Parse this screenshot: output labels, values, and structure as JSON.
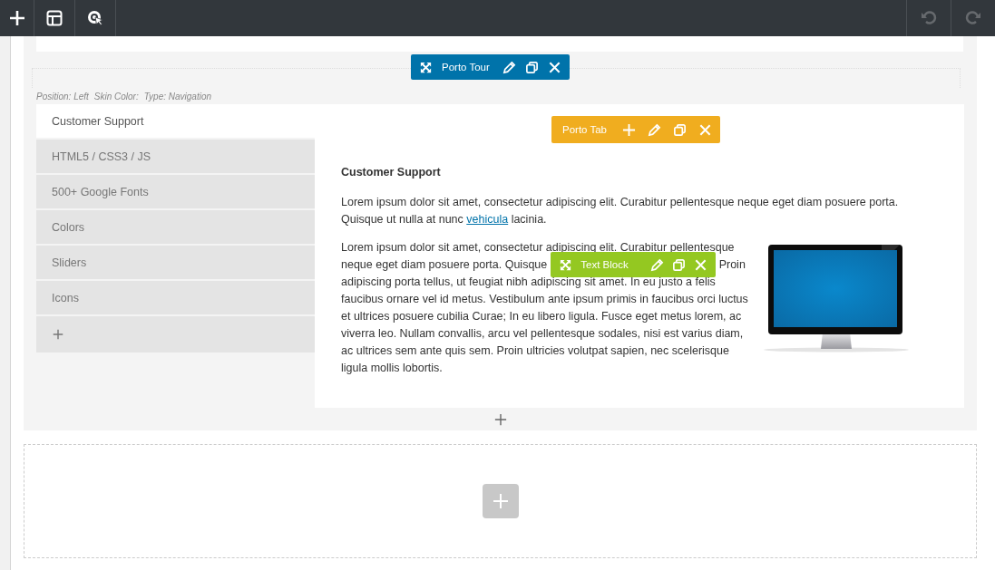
{
  "topbar": {
    "history": [
      {
        "kind": "undo",
        "disabled": true
      },
      {
        "kind": "redo",
        "disabled": true
      }
    ]
  },
  "tour_controls": {
    "title": "Porto Tour"
  },
  "tour_meta": [
    "Position: Left",
    "Skin Color:",
    "Type: Navigation"
  ],
  "tabs": [
    {
      "label": "Customer Support",
      "selected": true
    },
    {
      "label": "HTML5 / CSS3 / JS",
      "selected": false
    },
    {
      "label": "500+ Google Fonts",
      "selected": false
    },
    {
      "label": "Colors",
      "selected": false
    },
    {
      "label": "Sliders",
      "selected": false
    },
    {
      "label": "Icons",
      "selected": false
    }
  ],
  "tab_controls": {
    "title": "Porto Tab"
  },
  "content": {
    "heading": "Customer Support",
    "intro": {
      "before": "Lorem ipsum dolor sit amet, consectetur adipiscing elit. Curabitur pellentesque neque eget diam posuere porta. Quisque ut nulla at nunc",
      "link": "vehicula",
      "after": "lacinia."
    },
    "body": {
      "first_line": "Lorem ipsum dolor sit amet, consectetur adipiscing elit. Curabitur pellentesque",
      "second_line_start": "neque eget diam posuere porta. Quisque",
      "second_line_end": "Proin",
      "rest": "adipiscing porta tellus, ut feugiat nibh adipiscing sit amet. In eu justo a felis faucibus ornare vel id metus. Vestibulum ante ipsum primis in faucibus orci luctus et ultrices posuere cubilia Curae; In eu libero ligula. Fusce eget metus lorem, ac viverra leo. Nullam convallis, arcu vel pellentesque sodales, nisi est varius diam, ac ultrices sem ante quis sem. Proin ultricies volutpat sapien, nec scelerisque ligula mollis lobortis."
    }
  },
  "text_block_controls": {
    "title": "Text Block"
  }
}
